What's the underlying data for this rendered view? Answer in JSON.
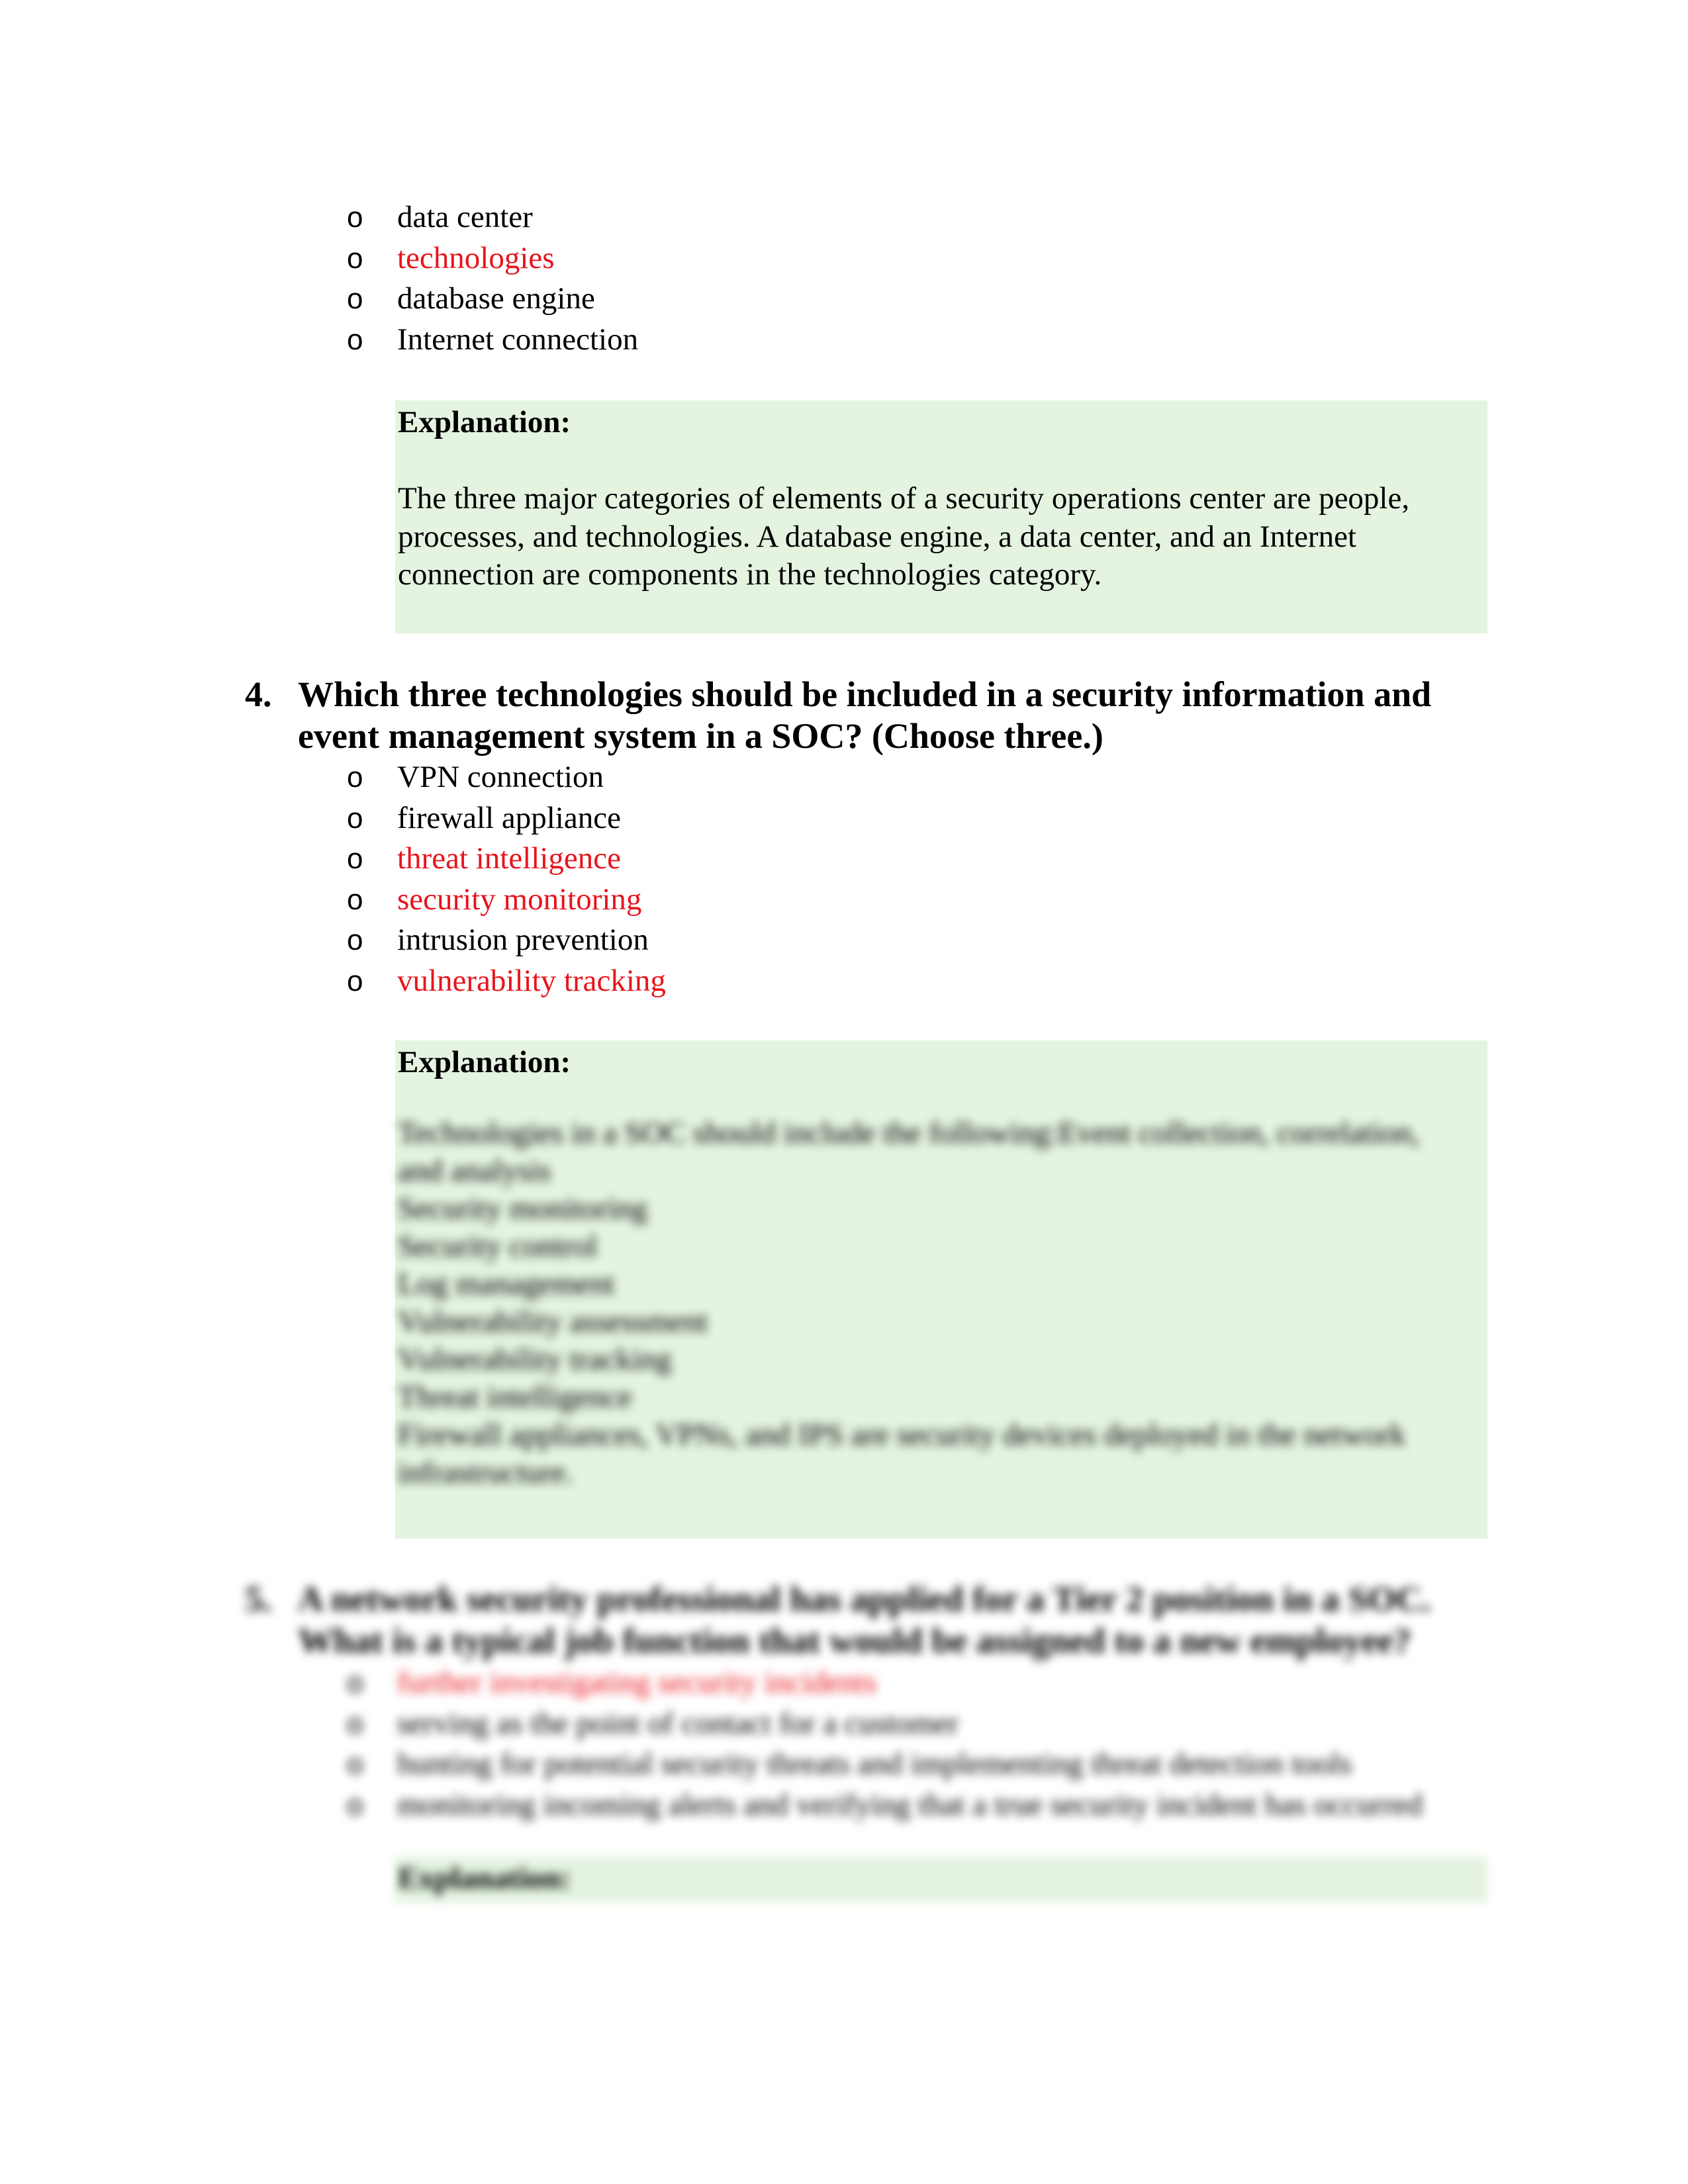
{
  "q3_tail": {
    "options": [
      {
        "text": "data center",
        "correct": false
      },
      {
        "text": "technologies",
        "correct": true
      },
      {
        "text": "database engine",
        "correct": false
      },
      {
        "text": "Internet connection",
        "correct": false
      }
    ],
    "explanation": {
      "title": "Explanation:",
      "body": "The three major categories of elements of a security operations center are people, processes, and technologies. A database engine, a data center, and an Internet connection are components in the technologies category."
    }
  },
  "q4": {
    "number": "4.",
    "text": "Which three technologies should be included in a security information and event management system in a SOC? (Choose three.)",
    "options": [
      {
        "text": "VPN connection",
        "correct": false
      },
      {
        "text": "firewall appliance",
        "correct": false
      },
      {
        "text": "threat intelligence",
        "correct": true
      },
      {
        "text": "security monitoring",
        "correct": true
      },
      {
        "text": "intrusion prevention",
        "correct": false
      },
      {
        "text": "vulnerability tracking",
        "correct": true
      }
    ],
    "explanation": {
      "title": "Explanation:",
      "body_lines": [
        "Technologies in a SOC should include the following:Event collection, correlation,",
        "and analysis",
        "Security monitoring",
        "Security control",
        "Log management",
        "Vulnerability assessment",
        "Vulnerability tracking",
        "Threat intelligence",
        "Firewall appliances, VPNs, and IPS are security devices deployed in the network",
        "infrastructure."
      ],
      "blurred": true
    }
  },
  "q5": {
    "number": "5.",
    "text": "A network security professional has applied for a Tier 2 position in a SOC. What is a typical job function that would be assigned to a new employee?",
    "options": [
      {
        "text": "further investigating security incidents",
        "correct": true
      },
      {
        "text": "serving as the point of contact for a customer",
        "correct": false
      },
      {
        "text": "hunting for potential security threats and implementing threat detection tools",
        "correct": false
      },
      {
        "text": "monitoring incoming alerts and verifying that a true security incident has occurred",
        "correct": false
      }
    ],
    "explanation": {
      "title": "Explanation:"
    },
    "blurred": true
  },
  "colors": {
    "correct_answer": "#e8141c",
    "explanation_bg": "#e4f4e0",
    "text": "#000000"
  },
  "bullet_glyph": "o"
}
